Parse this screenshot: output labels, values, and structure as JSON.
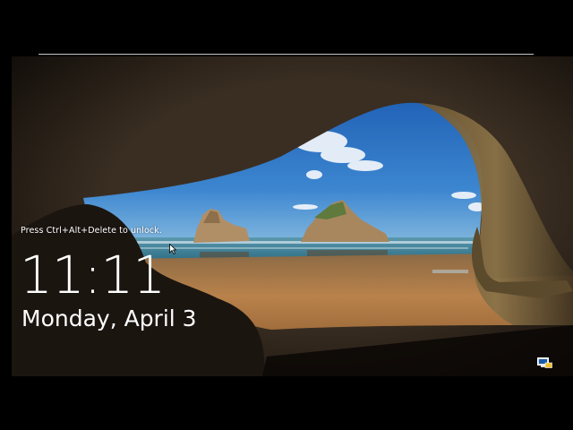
{
  "lockscreen": {
    "prompt_text": "Press Ctrl+Alt+Delete to unlock.",
    "time": "11:11",
    "date": "Monday, April 3"
  },
  "icons": {
    "cursor": "mouse-pointer-icon",
    "network": "network-status-icon"
  },
  "colors": {
    "sky": "#2f6fc0",
    "sea": "#3f7f9a",
    "sand": "#b57f48",
    "cave_rock": "#1f1a14",
    "text": "#ffffff"
  }
}
